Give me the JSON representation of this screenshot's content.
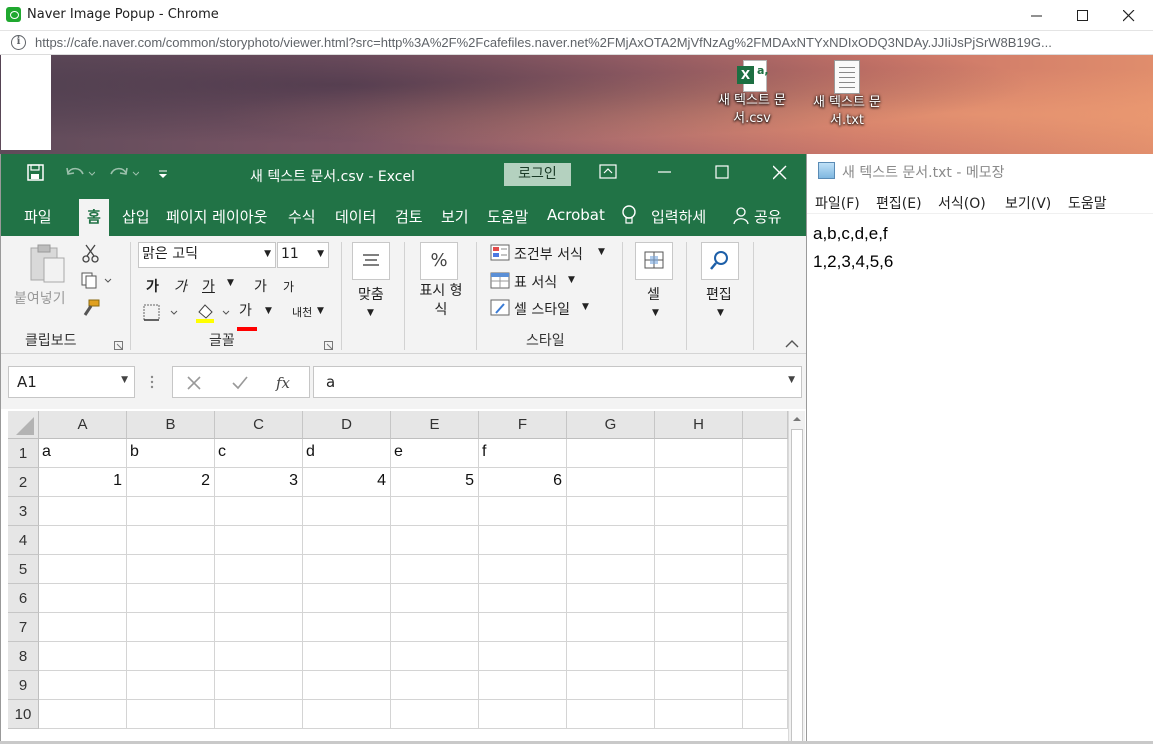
{
  "browser": {
    "title": "Naver Image Popup - Chrome",
    "url": "https://cafe.naver.com/common/storyphoto/viewer.html?src=http%3A%2F%2Fcafefiles.naver.net%2FMjAxOTA2MjVfNzAg%2FMDAxNTYxNDIxODQ3NDAy.JJIiJsPjSrW8B19G..."
  },
  "desktop": {
    "icons": [
      {
        "label": "새 텍스트 문서.csv",
        "icon": "excel-csv-file-icon"
      },
      {
        "label": "새 텍스트 문서.txt",
        "icon": "text-file-icon"
      }
    ]
  },
  "excel": {
    "doc_title": "새 텍스트 문서.csv  -  Excel",
    "login_label": "로그인",
    "tabs": [
      "파일",
      "홈",
      "삽입",
      "페이지 레이아웃",
      "수식",
      "데이터",
      "검토",
      "보기",
      "도움말",
      "Acrobat",
      "입력하세",
      "공유"
    ],
    "active_tab": "홈",
    "ribbon": {
      "clipboard": {
        "paste": "붙여넣기",
        "group": "클립보드"
      },
      "font": {
        "name": "맑은 고딕",
        "size": "11",
        "group": "글꼴",
        "bold": "가",
        "italic": "가",
        "underline": "가",
        "grow": "가",
        "shrink": "가",
        "color": "가",
        "phonetic": "내천"
      },
      "align": {
        "label": "맞춤"
      },
      "number": {
        "label": "표시 형식",
        "symbol": "%"
      },
      "styles": {
        "cond": "조건부 서식",
        "table": "표 서식",
        "cell": "셀 스타일",
        "group": "스타일"
      },
      "cells": {
        "label": "셀"
      },
      "editing": {
        "label": "편집"
      }
    },
    "name_box": "A1",
    "formula": "a",
    "columns": [
      "A",
      "B",
      "C",
      "D",
      "E",
      "F",
      "G",
      "H"
    ],
    "rows": [
      "1",
      "2",
      "3",
      "4",
      "5",
      "6",
      "7",
      "8",
      "9",
      "10"
    ],
    "data": [
      [
        "a",
        "b",
        "c",
        "d",
        "e",
        "f"
      ],
      [
        "1",
        "2",
        "3",
        "4",
        "5",
        "6"
      ]
    ]
  },
  "notepad": {
    "title": "새 텍스트 문서.txt - 메모장",
    "menu": [
      "파일(F)",
      "편집(E)",
      "서식(O)",
      "보기(V)",
      "도움말"
    ],
    "lines": [
      "a,b,c,d,e,f",
      "1,2,3,4,5,6"
    ]
  },
  "colors": {
    "excel_green": "#217346",
    "ribbon_bg": "#f3f3f3"
  }
}
